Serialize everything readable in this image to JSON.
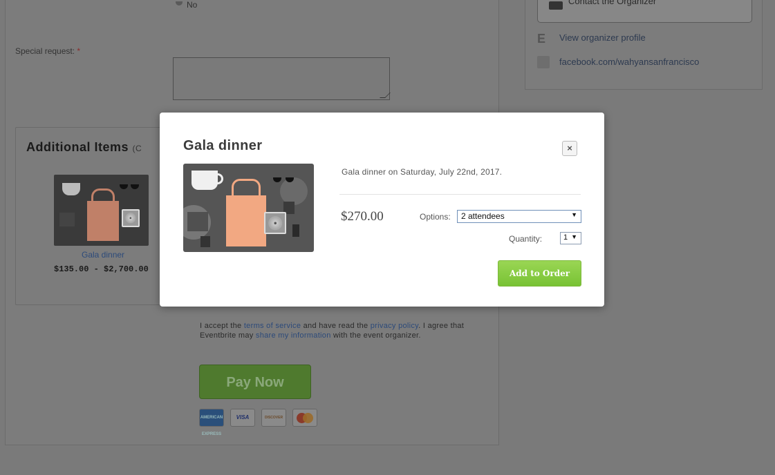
{
  "background_form": {
    "radio_no_label": "No",
    "special_request": {
      "label": "Special request:",
      "required_mark": "*",
      "value": ""
    },
    "sidebar": {
      "contact_button": "Contact the Organizer",
      "view_profile": "View organizer profile",
      "facebook": "facebook.com/wahyansanfrancisco"
    },
    "additional_items": {
      "title": "Additional Items",
      "title_suffix": "(C",
      "item": {
        "name": "Gala dinner",
        "price_range": "$135.00 - $2,700.00"
      }
    },
    "terms": {
      "part1": "I accept the ",
      "link_terms": "terms of service",
      "part2": " and have read the ",
      "link_privacy": "privacy policy",
      "part3": ". I agree that Eventbrite may ",
      "link_share": "share my information",
      "part4": " with the event organizer."
    },
    "pay_button": "Pay Now",
    "payment_cards": [
      "AMERICAN EXPRESS",
      "VISA",
      "DISCOVER",
      "MasterCard"
    ]
  },
  "modal": {
    "title": "Gala dinner",
    "close_label": "×",
    "description": "Gala dinner on Saturday, July 22nd, 2017.",
    "price": "$270.00",
    "options_label": "Options:",
    "options_selected": "2 attendees",
    "quantity_label": "Quantity:",
    "quantity_selected": "1",
    "add_button": "Add to Order"
  },
  "colors": {
    "overlay": "#7a7a7a",
    "modal_bg": "#ffffff",
    "add_button": "#86cc40",
    "link": "#2c4a7a"
  }
}
